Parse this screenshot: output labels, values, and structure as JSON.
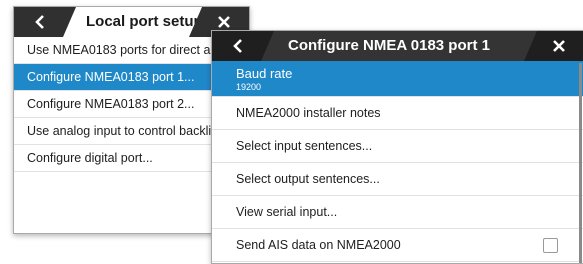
{
  "local": {
    "title": "Local port setup",
    "items": [
      {
        "label": "Use NMEA0183 ports for direct an"
      },
      {
        "label": "Configure NMEA0183 port 1..."
      },
      {
        "label": "Configure NMEA0183 port 2..."
      },
      {
        "label": "Use analog input to control backli"
      },
      {
        "label": "Configure digital port..."
      }
    ]
  },
  "dialog": {
    "title": "Configure NMEA 0183 port 1",
    "baud": {
      "label": "Baud rate",
      "value": "19200"
    },
    "items": [
      {
        "label": "NMEA2000 installer notes"
      },
      {
        "label": "Select input sentences..."
      },
      {
        "label": "Select output sentences..."
      },
      {
        "label": "View serial input..."
      },
      {
        "label": "Send AIS data on NMEA2000"
      }
    ]
  },
  "icons": {
    "back": "chevron-left-icon",
    "close": "close-icon"
  },
  "colors": {
    "selection": "#1f88c9",
    "titlebar_dark": "#343434"
  }
}
